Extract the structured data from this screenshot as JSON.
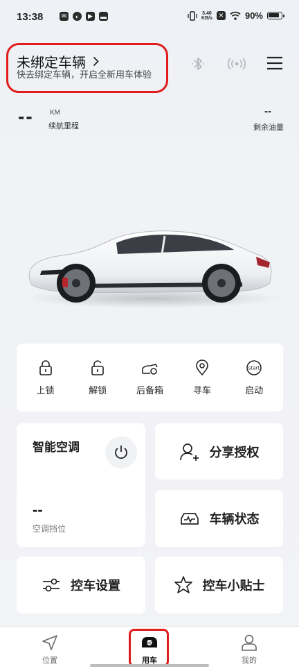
{
  "status_bar": {
    "time": "13:38",
    "net_speed_value": "3.40",
    "net_speed_unit": "KB/s",
    "battery": "90%"
  },
  "header": {
    "vehicle_title": "未绑定车辆",
    "vehicle_subtitle": "快去绑定车辆，开启全新用车体验"
  },
  "stats": {
    "range_value": "--",
    "range_unit": "KM",
    "range_label": "续航里程",
    "fuel_value": "--",
    "fuel_label": "剩余油量"
  },
  "controls": [
    {
      "label": "上锁",
      "icon": "lock-icon"
    },
    {
      "label": "解锁",
      "icon": "unlock-icon"
    },
    {
      "label": "后备箱",
      "icon": "trunk-icon"
    },
    {
      "label": "寻车",
      "icon": "location-pin-icon"
    },
    {
      "label": "启动",
      "icon": "start-icon"
    }
  ],
  "start_icon_text": "start",
  "ac": {
    "title": "智能空调",
    "value": "--",
    "label": "空调挡位"
  },
  "features": {
    "share": "分享授权",
    "status": "车辆状态",
    "settings": "控车设置",
    "tips": "控车小贴士"
  },
  "tabs": [
    {
      "label": "位置"
    },
    {
      "label": "用车"
    },
    {
      "label": "我的"
    }
  ],
  "colors": {
    "highlight": "#e01c1c",
    "card": "#ffffff",
    "background": "#f1f2f5"
  }
}
